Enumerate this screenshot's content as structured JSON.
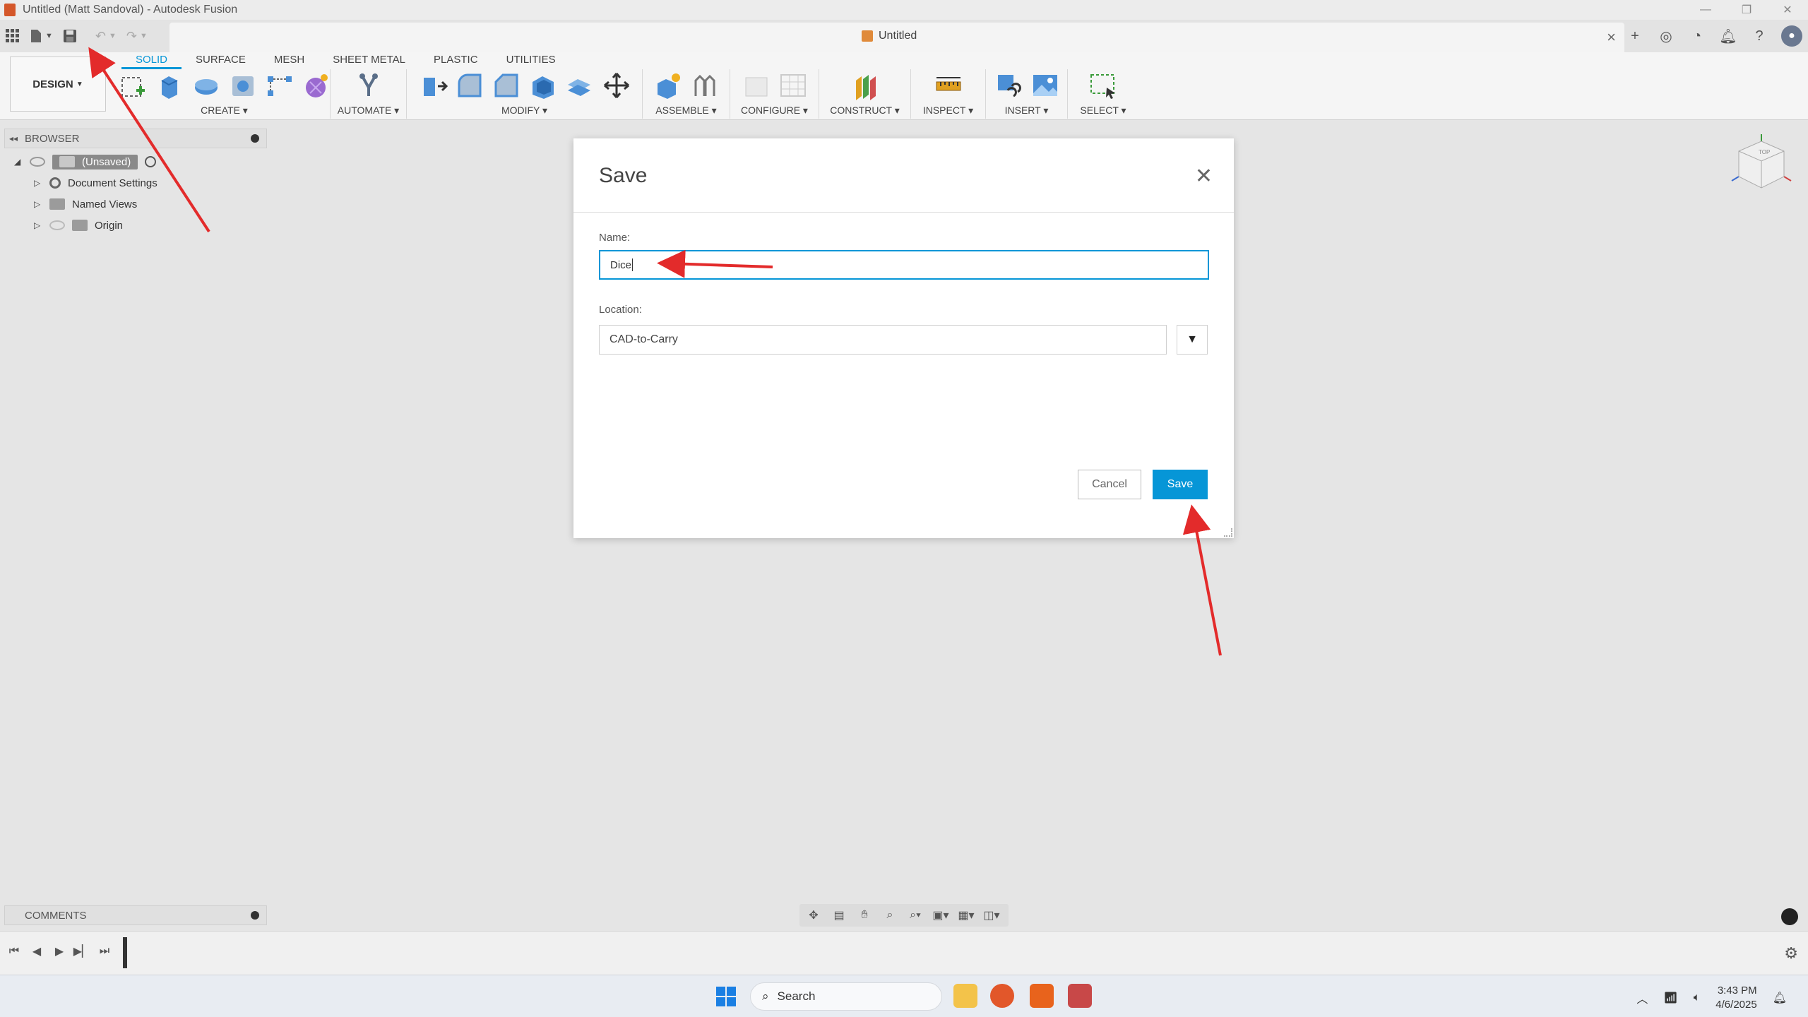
{
  "window": {
    "title": "Untitled (Matt Sandoval) - Autodesk Fusion",
    "document_tab": "Untitled"
  },
  "ribbon": {
    "workspace": "DESIGN",
    "tabs": [
      "SOLID",
      "SURFACE",
      "MESH",
      "SHEET METAL",
      "PLASTIC",
      "UTILITIES"
    ],
    "active_tab": "SOLID",
    "groups": [
      "CREATE",
      "AUTOMATE",
      "MODIFY",
      "ASSEMBLE",
      "CONFIGURE",
      "CONSTRUCT",
      "INSPECT",
      "INSERT",
      "SELECT"
    ]
  },
  "browser": {
    "header": "BROWSER",
    "root": "(Unsaved)",
    "items": [
      "Document Settings",
      "Named Views",
      "Origin"
    ]
  },
  "dialog": {
    "title": "Save",
    "name_label": "Name:",
    "name_value": "Dice",
    "location_label": "Location:",
    "location_value": "CAD-to-Carry",
    "cancel_label": "Cancel",
    "save_label": "Save"
  },
  "comments": {
    "header": "COMMENTS"
  },
  "taskbar": {
    "search_label": "Search",
    "time": "3:43 PM",
    "date": "4/6/2025"
  },
  "colors": {
    "accent": "#0696d7",
    "annotation_arrow": "#e32b2b"
  }
}
